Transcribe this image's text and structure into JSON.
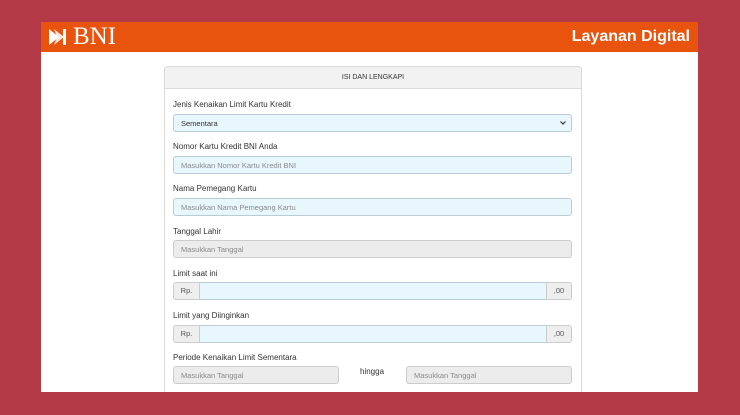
{
  "brand": {
    "logo_text": "BNI",
    "service_title": "Layanan Digital"
  },
  "colors": {
    "background": "#b53a47",
    "header": "#e8530e",
    "field_fill": "#e8f6fe",
    "field_disabled": "#ececec"
  },
  "form": {
    "title": "ISI DAN LENGKAPI",
    "jenis": {
      "label": "Jenis Kenaikan Limit Kartu Kredit",
      "selected": "Sementara"
    },
    "nomor": {
      "label": "Nomor Kartu Kredit BNI Anda",
      "placeholder": "Masukkan Nomor Kartu Kredit BNI"
    },
    "nama": {
      "label": "Nama Pemegang Kartu",
      "placeholder": "Masukkan Nama Pemegang Kartu"
    },
    "tanggal_lahir": {
      "label": "Tanggal Lahir",
      "placeholder": "Masukkan Tanggal"
    },
    "limit_saat_ini": {
      "label": "Limit saat ini",
      "prefix": "Rp.",
      "suffix": ",00"
    },
    "limit_diinginkan": {
      "label": "Limit yang Diinginkan",
      "prefix": "Rp.",
      "suffix": ",00"
    },
    "periode": {
      "label": "Periode Kenaikan Limit Sementara",
      "from_placeholder": "Masukkan Tanggal",
      "separator": "hingga",
      "to_placeholder": "Masukkan Tanggal"
    }
  }
}
